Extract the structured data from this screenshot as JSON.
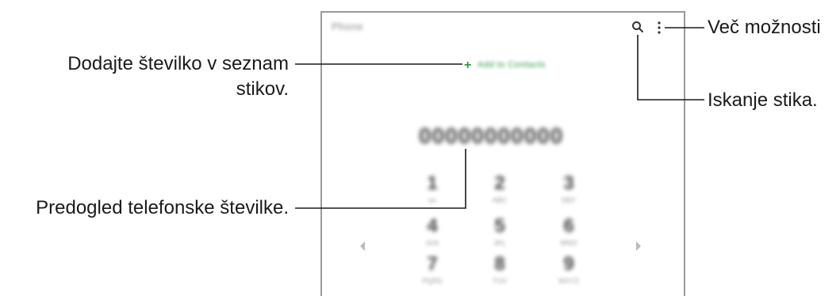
{
  "app": {
    "title": "Phone",
    "add_contact_text": "Add to Contacts",
    "number": "00000000000",
    "keys": [
      {
        "digit": "1",
        "sub": "oo"
      },
      {
        "digit": "2",
        "sub": "ABC"
      },
      {
        "digit": "3",
        "sub": "DEF"
      },
      {
        "digit": "4",
        "sub": "GHI"
      },
      {
        "digit": "5",
        "sub": "JKL"
      },
      {
        "digit": "6",
        "sub": "MNO"
      },
      {
        "digit": "7",
        "sub": "PQRS"
      },
      {
        "digit": "8",
        "sub": "TUV"
      },
      {
        "digit": "9",
        "sub": "WXYZ"
      }
    ]
  },
  "callouts": {
    "more_options": "Več možnosti",
    "add_number_line1": "Dodajte številko v seznam",
    "add_number_line2": "stikov.",
    "search_contact": "Iskanje stika.",
    "preview_number": "Predogled telefonske številke."
  },
  "colors": {
    "accent_green": "#2f9a3a",
    "frame_gray": "#9a9a9a",
    "text_dark": "#1a1a1a"
  },
  "icons": [
    "search-icon",
    "more-options-icon",
    "plus-icon",
    "left-arrow-icon",
    "right-arrow-icon"
  ]
}
